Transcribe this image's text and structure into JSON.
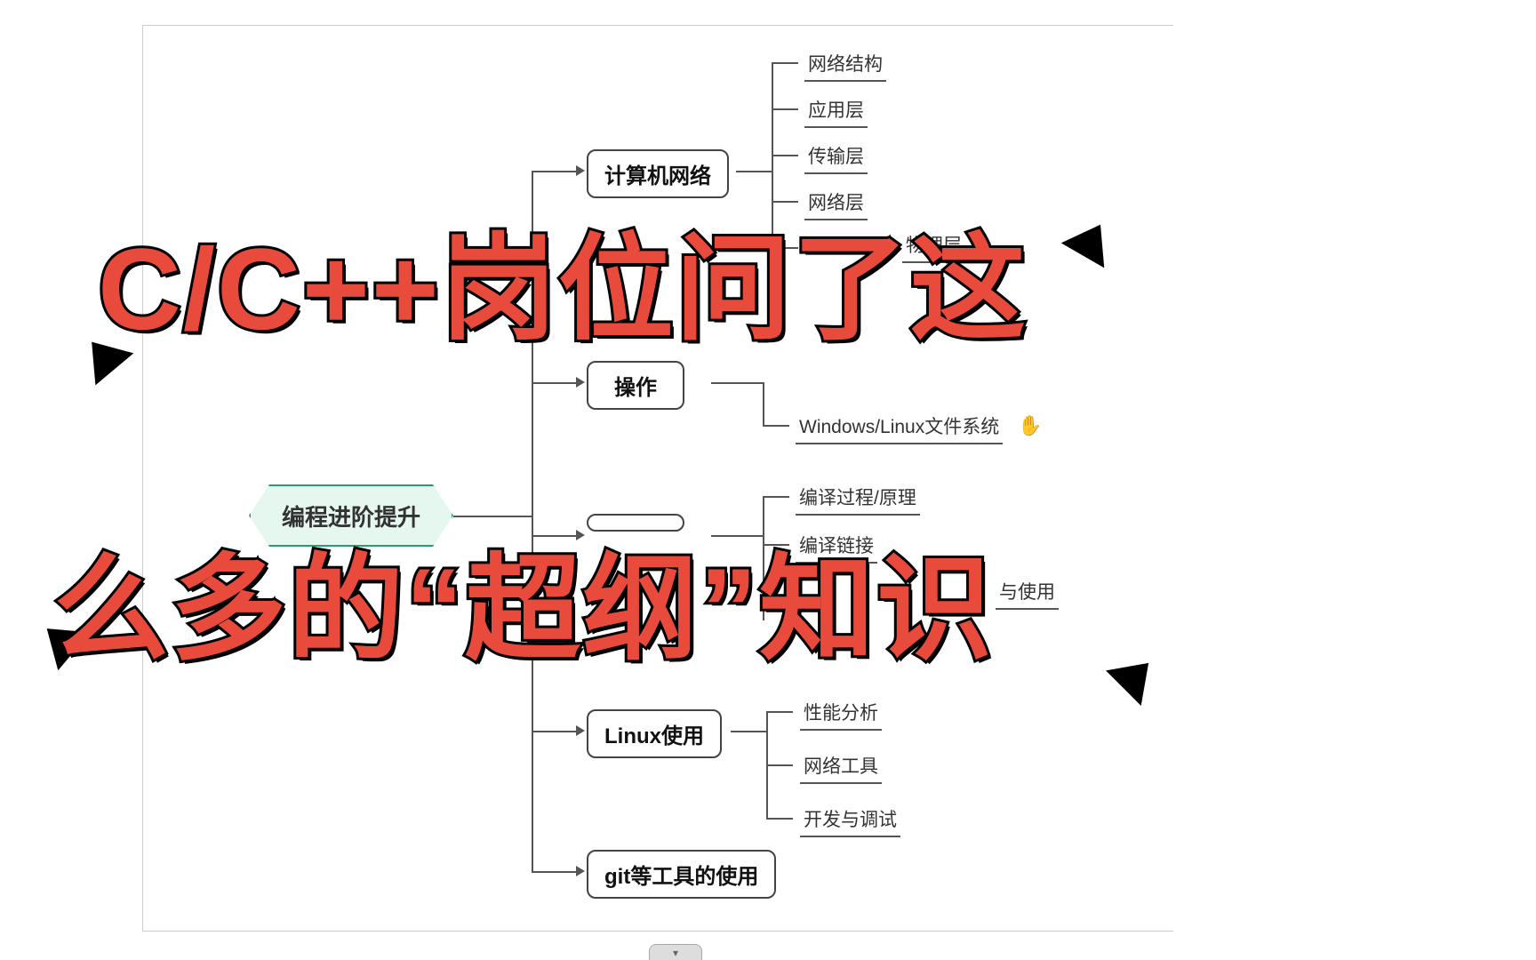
{
  "overlay": {
    "line1": "C/C++岗位问了这",
    "line2": "么多的“超纲”知识"
  },
  "mindmap": {
    "root": "编程进阶提升",
    "branches": [
      {
        "label": "计算机网络",
        "leaves": [
          "网络结构",
          "应用层",
          "传输层",
          "网络层",
          "物理层"
        ]
      },
      {
        "label": "操作",
        "leaves": [
          "Windows/Linux文件系统"
        ]
      },
      {
        "label": "",
        "leaves": [
          "编译过程/原理",
          "编译链接",
          "与使用"
        ]
      },
      {
        "label": "Linux使用",
        "leaves": [
          "性能分析",
          "网络工具",
          "开发与调试"
        ]
      },
      {
        "label": "git等工具的使用",
        "leaves": []
      }
    ]
  },
  "ui": {
    "collapse_glyph": "▾"
  }
}
